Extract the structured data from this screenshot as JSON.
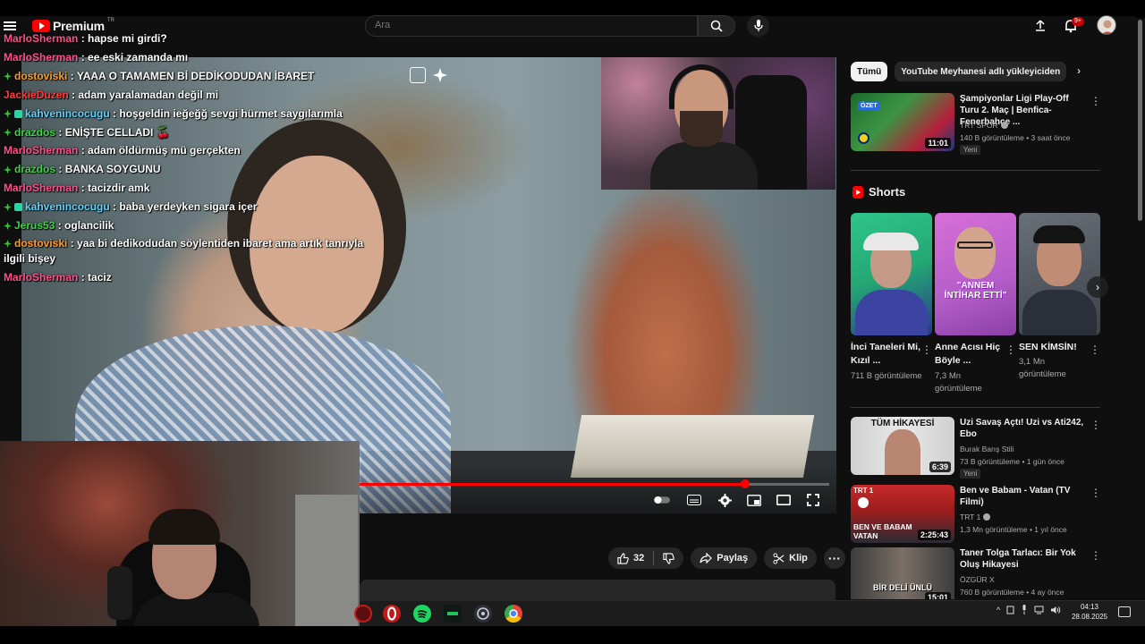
{
  "header": {
    "logo_text": "Premium",
    "logo_region": "TR",
    "search_placeholder": "Ara",
    "notification_count": "9+"
  },
  "chat": [
    {
      "user": "MarloSherman",
      "color": "#ff4f8b",
      "badge": "",
      "text": "hapse mi girdi?"
    },
    {
      "user": "MarloSherman",
      "color": "#ff4f8b",
      "badge": "",
      "text": "ee eski zamanda mı"
    },
    {
      "user": "dostoviski",
      "color": "#ff9c2a",
      "badge": "green",
      "text": "YAAA O TAMAMEN Bİ DEDİKODUDAN İBARET"
    },
    {
      "user": "JackieDuzen",
      "color": "#ff3b3b",
      "badge": "",
      "text": "adam yaralamadan değil mi"
    },
    {
      "user": "kahvenincocugu",
      "color": "#5fd3ff",
      "badge": "green-sub",
      "text": "hoşgeldin ieğeğğ sevgi hürmet saygılarımla"
    },
    {
      "user": "drazdos",
      "color": "#41d14a",
      "badge": "green",
      "text": "ENİŞTE CELLADI 🍒"
    },
    {
      "user": "MarloSherman",
      "color": "#ff4f8b",
      "badge": "",
      "text": "adam öldürmüş mü gerçekten"
    },
    {
      "user": "drazdos",
      "color": "#41d14a",
      "badge": "green",
      "text": "BANKA SOYGUNU"
    },
    {
      "user": "MarloSherman",
      "color": "#ff4f8b",
      "badge": "",
      "text": "tacizdir amk"
    },
    {
      "user": "kahvenincocugu",
      "color": "#5fd3ff",
      "badge": "green-sub",
      "text": "baba yerdeyken sigara içer"
    },
    {
      "user": "Jerus53",
      "color": "#41d14a",
      "badge": "green",
      "text": "oglancilik"
    },
    {
      "user": "dostoviski",
      "color": "#ff9c2a",
      "badge": "green",
      "text": "yaa bi dedikodudan söylentiden ibaret ama artık tanrıyla ilgili bişey",
      "wrap": true
    },
    {
      "user": "MarloSherman",
      "color": "#ff4f8b",
      "badge": "",
      "text": "taciz"
    }
  ],
  "player": {
    "progress_fraction": 0.82
  },
  "actions": {
    "like_count": "32",
    "share_label": "Paylaş",
    "clip_label": "Klip"
  },
  "sidebar": {
    "chips": [
      "Tümü",
      "YouTube Meyhanesi adlı yükleyiciden"
    ],
    "top_video": {
      "title": "Şampiyonlar Ligi Play-Off Turu 2. Maç | Benfica-Fenerbahçe ...",
      "channel": "TRT SPOR",
      "meta": "140 B görüntüleme • 3 saat önce",
      "badge": "Yeni",
      "duration": "11:01",
      "thumb_label": "ÖZET"
    },
    "shorts_title": "Shorts",
    "shorts": [
      {
        "title": "İnci Taneleri Mi, Kızıl ...",
        "views": "711 B görüntüleme"
      },
      {
        "title": "Anne Acısı Hiç Böyle ...",
        "views": "7,3 Mn görüntüleme",
        "thumb_text": "\"ANNEM İNTİHAR ETTİ\""
      },
      {
        "title": "SEN KİMSİN!",
        "views": "3,1 Mn görüntüleme"
      }
    ],
    "videos": [
      {
        "title": "Uzi Savaş Açtı! Uzi vs Ati242, Ebo",
        "channel": "Burak Barış Stili",
        "meta": "73 B görüntüleme • 1 gün önce",
        "badge": "Yeni",
        "duration": "6:39",
        "thumb_text": "TÜM HİKAYESİ"
      },
      {
        "title": "Ben ve Babam - Vatan (TV Filmi)",
        "channel": "TRT 1",
        "meta": "1,3 Mn görüntüleme • 1 yıl önce",
        "badge": "",
        "duration": "2:25:43",
        "thumb_text": "BEN VE BABAM VATAN",
        "thumb_brand": "TRT 1"
      },
      {
        "title": "Taner Tolga Tarlacı: Bir Yok Oluş Hikayesi",
        "channel": "ÖZGÜR X",
        "meta": "760 B görüntüleme • 4 ay önce",
        "badge": "",
        "duration": "15:01",
        "thumb_text": "BİR DELİ ÜNLÜ"
      }
    ]
  },
  "taskbar": {
    "time": "04:13",
    "date": "28.08.2025"
  }
}
